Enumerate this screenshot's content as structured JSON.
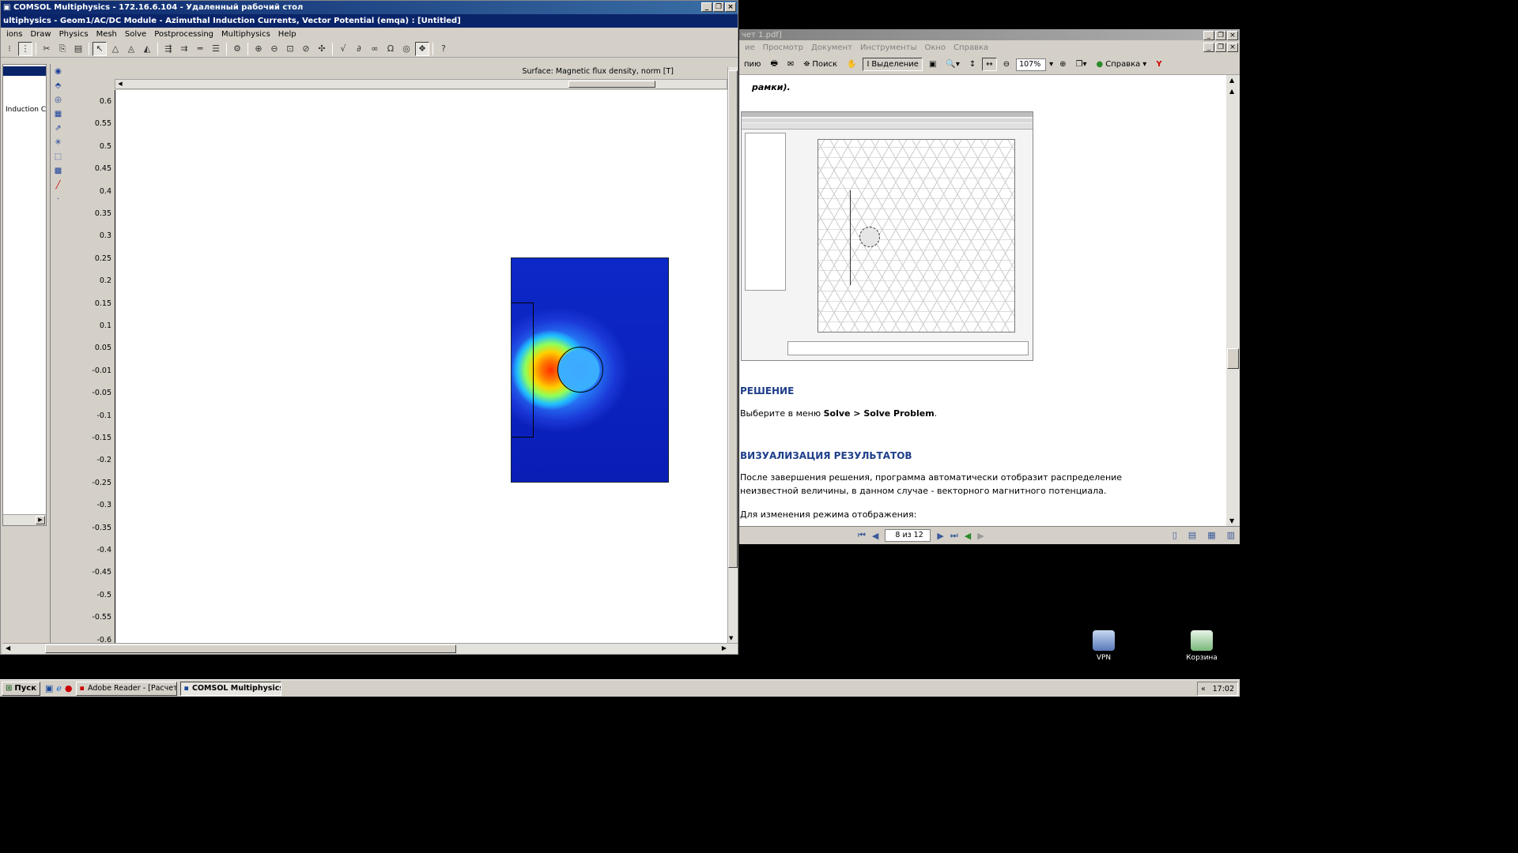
{
  "rdp_window": {
    "title": "COMSOL Multiphysics - 172.16.6.104 - Удаленный рабочий стол",
    "inner_title": "ultiphysics - Geom1/AC/DC Module - Azimuthal Induction Currents, Vector Potential (emqa) : [Untitled]",
    "menu": [
      "ions",
      "Draw",
      "Physics",
      "Mesh",
      "Solve",
      "Postprocessing",
      "Multiphysics",
      "Help"
    ],
    "tree_item": "Induction Cur",
    "plot_title": "Surface: Magnetic flux density, norm [T]",
    "y_ticks": [
      "0.6",
      "0.55",
      "0.5",
      "0.45",
      "0.4",
      "0.35",
      "0.3",
      "0.25",
      "0.2",
      "0.15",
      "0.1",
      "0.05",
      "-0.01",
      "-0.05",
      "-0.1",
      "-0.15",
      "-0.2",
      "-0.25",
      "-0.3",
      "-0.35",
      "-0.4",
      "-0.45",
      "-0.5",
      "-0.55",
      "-0.6"
    ]
  },
  "reader_window": {
    "title": "чет 1.pdf]",
    "menu": [
      "ие",
      "Просмотр",
      "Документ",
      "Инструменты",
      "Окно",
      "Справка"
    ],
    "toolbar": {
      "print": "пию",
      "search": "Поиск",
      "select": "Выделение",
      "zoom": "107%",
      "help": "Справка"
    },
    "page": {
      "cut_line": "рамки).",
      "h_solution": "РЕШЕНИЕ",
      "p_solution_prefix": "Выберите в меню ",
      "p_solution_bold": "Solve > Solve Problem",
      "p_solution_suffix": ".",
      "h_vis": "ВИЗУАЛИЗАЦИЯ РЕЗУЛЬТАТОВ",
      "p_vis": "После завершения решения, программа автоматически отобразит распределение неизвестной величины, в данном случае - векторного магнитного потенциала.",
      "p_mode": "Для изменения режима отображения:"
    },
    "page_indicator": "8 из 12"
  },
  "desktop_icons": [
    {
      "label": "VPN",
      "icon": "vpn-icon"
    },
    {
      "label": "Корзина",
      "icon": "recycle-bin-icon"
    }
  ],
  "taskbar": {
    "start": "Пуск",
    "tasks": [
      "Adobe Reader - [Расчет...",
      "COMSOL Multiphysics ..."
    ],
    "clock": "17:02"
  }
}
